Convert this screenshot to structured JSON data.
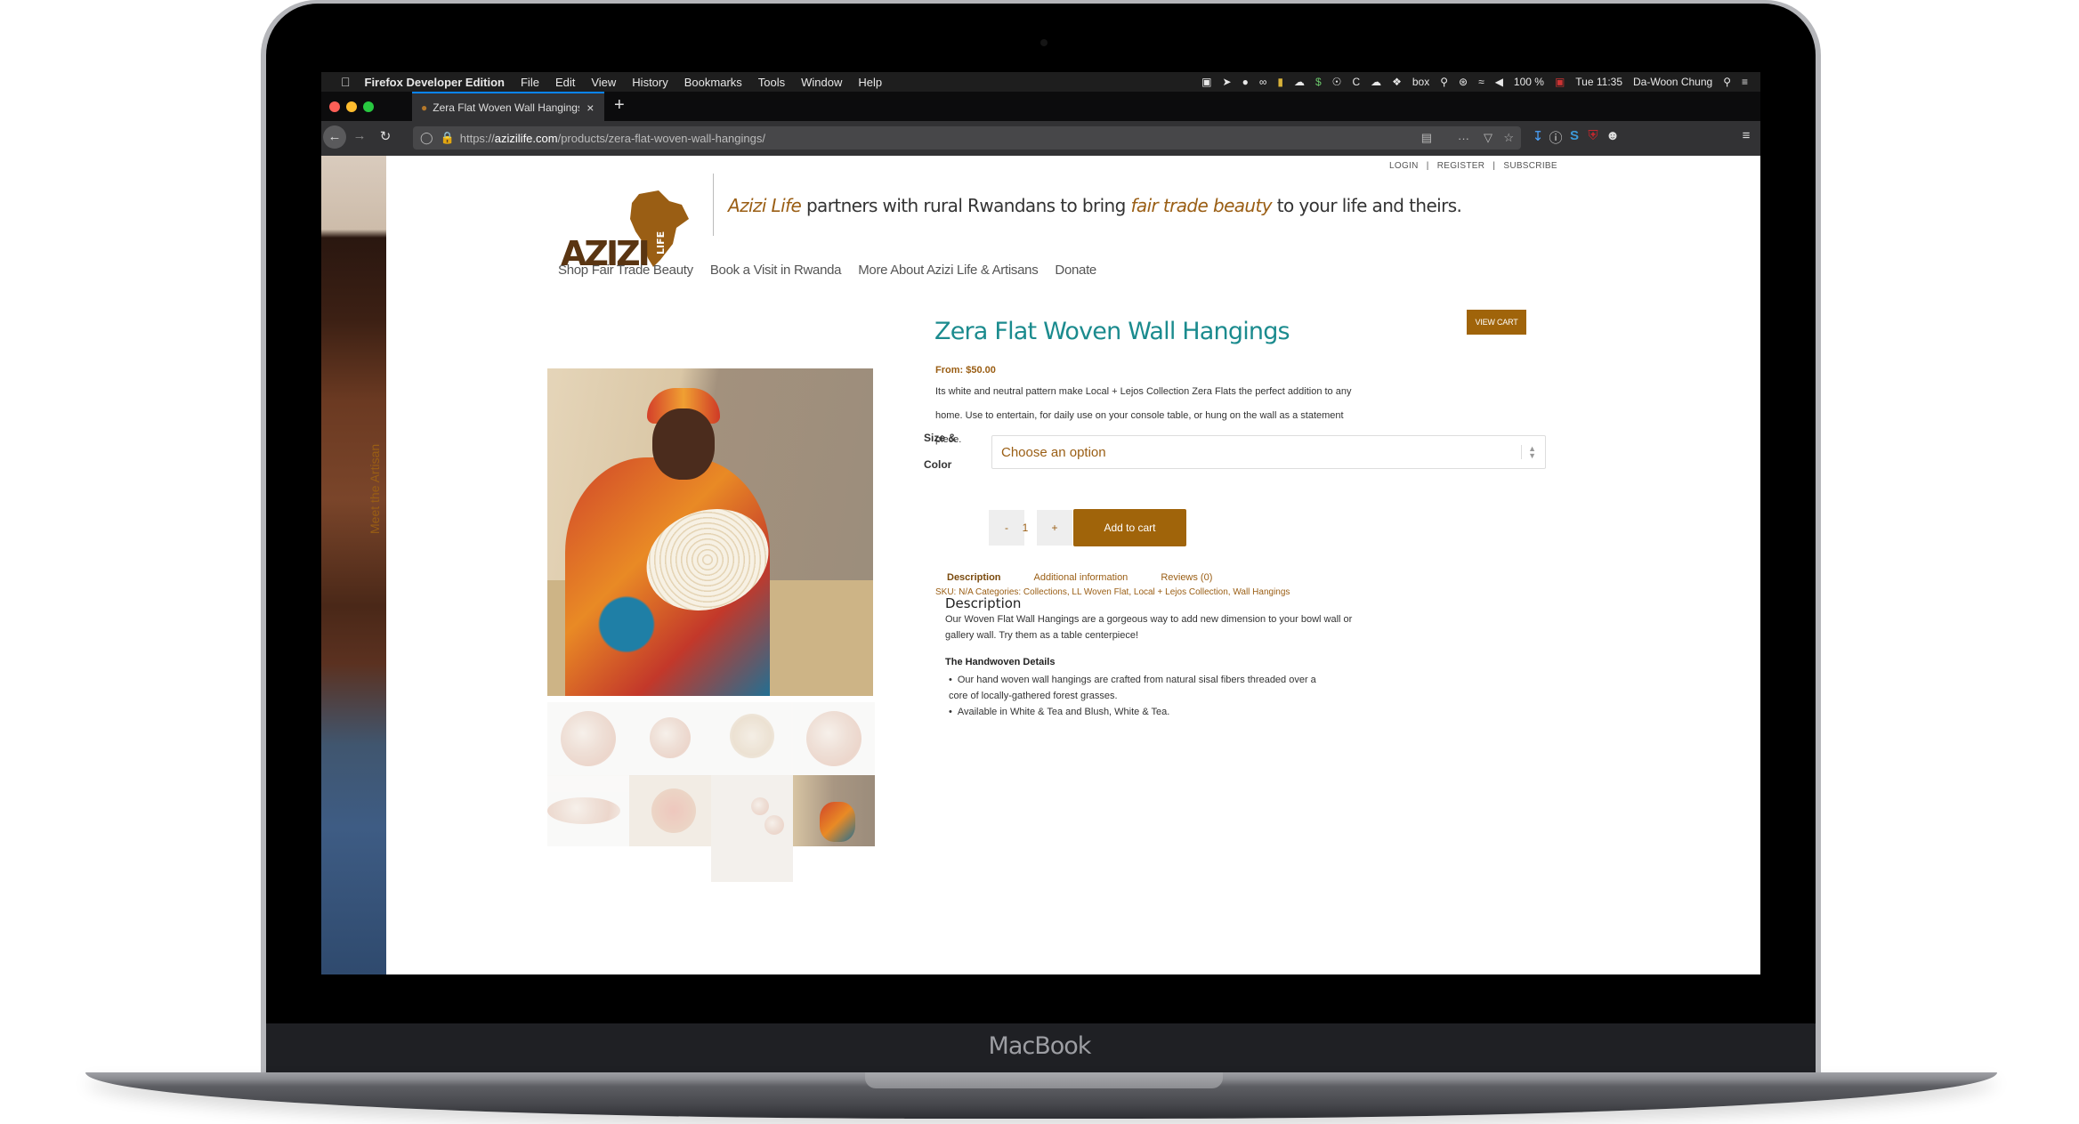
{
  "device": {
    "label": "MacBook"
  },
  "menubar": {
    "apple": "",
    "app_name": "Firefox Developer Edition",
    "items": [
      "File",
      "Edit",
      "View",
      "History",
      "Bookmarks",
      "Tools",
      "Window",
      "Help"
    ],
    "status_icons": [
      "screen-icon",
      "telegram-icon",
      "chat-icon",
      "creative-cloud-icon",
      "shield-icon",
      "upload-cloud-icon",
      "dollar-icon",
      "1password-icon",
      "c-icon",
      "cloud-icon",
      "dropbox-icon",
      "box-icon",
      "key-icon",
      "bluetooth-icon",
      "wifi-icon",
      "volume-icon"
    ],
    "box_text": "box",
    "battery": "100 %",
    "clock": "Tue 11:35",
    "user": "Da-Woon Chung"
  },
  "browser": {
    "tab_title": "Zera Flat Woven Wall Hangings",
    "url_prefix": "https://",
    "url_host": "azizilife.com",
    "url_path": "/products/zera-flat-woven-wall-hangings/"
  },
  "site": {
    "top_links": [
      "LOGIN",
      "REGISTER",
      "SUBSCRIBE"
    ],
    "logo_text": "AZIZI",
    "logo_sub": "LIFE",
    "tagline": {
      "brand": "Azizi Life",
      "mid": " partners with rural Rwandans to bring ",
      "accent": "fair trade beauty",
      "end": " to your life and theirs."
    },
    "nav": [
      "Shop Fair Trade Beauty",
      "Book a Visit in Rwanda",
      "More About Azizi Life & Artisans",
      "Donate"
    ],
    "view_cart": "VIEW CART",
    "side_link": "Meet the Artisan",
    "accent_color": "#9a5e14",
    "title_color": "#1b8b8e"
  },
  "product": {
    "title": "Zera Flat Woven Wall Hangings",
    "price": "From: $50.00",
    "short_description": "Its white and neutral pattern make Local + Lejos Collection Zera Flats the perfect addition to any home. Use to entertain, for daily use on your console table, or hung on the wall as a statement piece.",
    "option_label": "Size & Color",
    "option_placeholder": "Choose an option",
    "qty_minus": "-",
    "quantity": "1",
    "qty_plus": "+",
    "add_to_cart": "Add to cart",
    "meta": "SKU: N/A Categories: Collections, LL Woven Flat, Local + Lejos Collection, Wall Hangings",
    "tabs": [
      "Description",
      "Additional information",
      "Reviews (0)"
    ],
    "description_heading": "Description",
    "description": "Our Woven Flat Wall Hangings are a gorgeous way to add new dimension to your bowl wall or gallery wall.  Try them as a table centerpiece!",
    "details_heading": "The Handwoven Details",
    "details": [
      "Our hand woven wall hangings are crafted from natural sisal fibers threaded over a core of locally-gathered forest grasses.",
      "Available in White & Tea and Blush, White & Tea."
    ]
  }
}
